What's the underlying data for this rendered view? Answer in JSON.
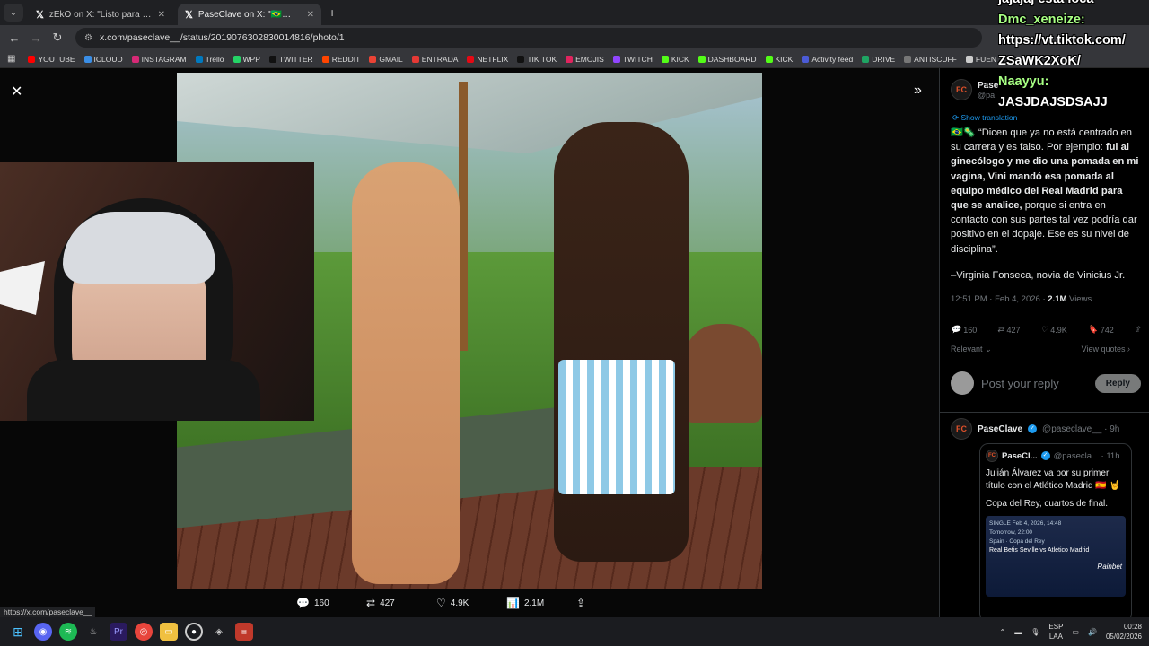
{
  "browser": {
    "tabs": [
      {
        "title": "zEkO on X: \"Listo para la oficina",
        "active": false
      },
      {
        "title": "PaseClave on X: \"🇧🇷🦠 \"Dicen q",
        "active": true
      }
    ],
    "url": "x.com/paseclave__/status/2019076302830014816/photo/1",
    "status_url": "https://x.com/paseclave__"
  },
  "bookmarks": [
    {
      "label": "YOUTUBE",
      "color": "#ff0000"
    },
    {
      "label": "ICLOUD",
      "color": "#3a8ee6"
    },
    {
      "label": "INSTAGRAM",
      "color": "#d62976"
    },
    {
      "label": "Trello",
      "color": "#0079bf"
    },
    {
      "label": "WPP",
      "color": "#25d366"
    },
    {
      "label": "TWITTER",
      "color": "#000000"
    },
    {
      "label": "REDDIT",
      "color": "#ff4500"
    },
    {
      "label": "GMAIL",
      "color": "#ea4335"
    },
    {
      "label": "ENTRADA",
      "color": "#e53935"
    },
    {
      "label": "NETFLIX",
      "color": "#e50914"
    },
    {
      "label": "TIK TOK",
      "color": "#111111"
    },
    {
      "label": "EMOJIS",
      "color": "#e0245e"
    },
    {
      "label": "TWITCH",
      "color": "#9146ff"
    },
    {
      "label": "KICK",
      "color": "#53fc18"
    },
    {
      "label": "DASHBOARD",
      "color": "#53fc18"
    },
    {
      "label": "KICK",
      "color": "#53fc18"
    },
    {
      "label": "Activity feed",
      "color": "#4b5bd6"
    },
    {
      "label": "DRIVE",
      "color": "#1fa463"
    },
    {
      "label": "ANTISCUFF",
      "color": "#777777"
    },
    {
      "label": "FUEN",
      "color": "#cccccc"
    }
  ],
  "photo_actions": {
    "replies": "160",
    "reposts": "427",
    "likes": "4.9K",
    "views": "2.1M"
  },
  "sidebar": {
    "author_name": "Pase",
    "author_handle": "@pa",
    "show_translation": "Show translation",
    "tweet_segments": [
      {
        "text": "🇧🇷🦠 “Dicen que ya no está centrado en su carrera y es falso. Por ejemplo: ",
        "bold": false
      },
      {
        "text": "fui al ginecólogo y me dio una pomada en mi vagina, Vini mandó esa pomada al equipo médico del Real Madrid para que se analice,",
        "bold": true
      },
      {
        "text": " porque si entra en contacto con sus partes tal vez podría dar positivo en el dopaje. Ese es su nivel de disciplina”.",
        "bold": false
      }
    ],
    "quote_attribution": "–Virginia Fonseca, novia de Vinicius Jr.",
    "timestamp": "12:51 PM · Feb 4, 2026 · ",
    "views_count": "2.1M",
    "views_label": " Views",
    "stats": {
      "replies": "160",
      "reposts": "427",
      "likes": "4.9K",
      "bookmarks": "742"
    },
    "relevant": "Relevant",
    "view_quotes": "View quotes",
    "reply_placeholder": "Post your reply",
    "reply_button": "Reply",
    "second_tweet": {
      "name": "PaseClave",
      "handle": "@paseclave__ · 9h",
      "quoted_name": "PaseCl...",
      "quoted_handle": "@pasecla... · 11h",
      "quoted_text": "Julián Álvarez va por su primer título con el Atlético Madrid 🇪🇸 🤘",
      "quoted_text2": "Copa del Rey, cuartos de final.",
      "card_line1": "SINGLE  Feb 4, 2026, 14:48",
      "card_line2": "Tomorrow, 22:00",
      "card_line3": "Spain · Copa del Rey",
      "card_line4": "Real Betis Seville vs Atletico Madrid",
      "card_brand": "Rainbet"
    }
  },
  "chat_overlay": {
    "line1": "jajajaj esta loca",
    "user1": "Dmc_xeneize:",
    "msg1a": "https://vt.tiktok.com/",
    "msg1b": "ZSaWK2XoK/",
    "user2": "Naayyu:",
    "msg2": "JASJDAJSDSAJJ"
  },
  "taskbar": {
    "lang_top": "ESP",
    "lang_bottom": "LAA",
    "time": "00:28",
    "date": "05/02/2026"
  }
}
